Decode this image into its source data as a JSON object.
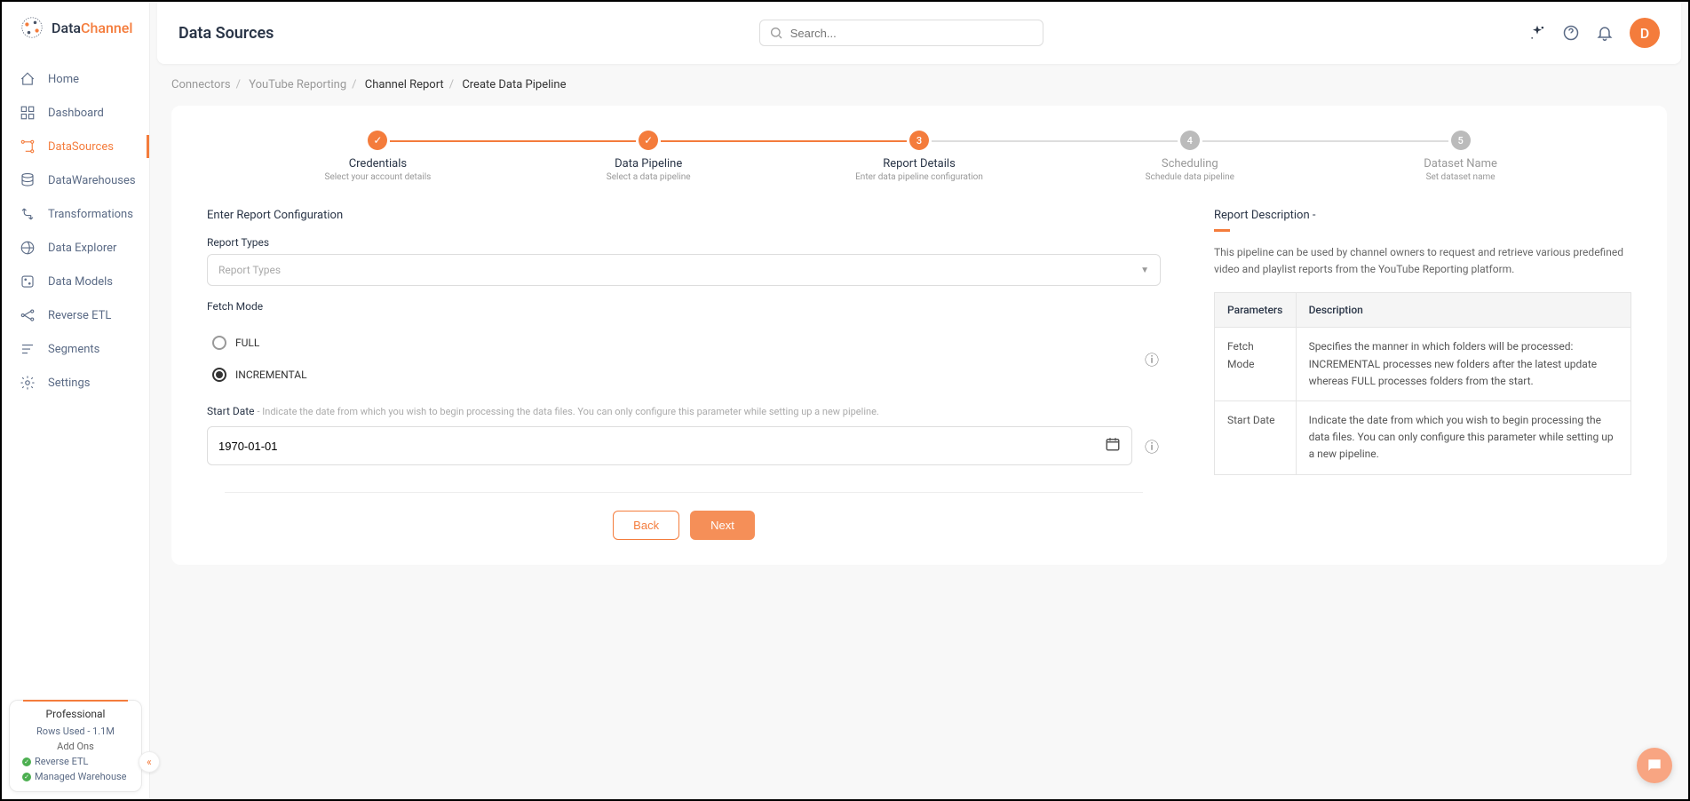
{
  "logo": {
    "brand1": "Data",
    "brand2": "Channel"
  },
  "pageTitle": "Data Sources",
  "search": {
    "placeholder": "Search..."
  },
  "avatar": "D",
  "sidebar": {
    "items": [
      {
        "label": "Home"
      },
      {
        "label": "Dashboard"
      },
      {
        "label": "DataSources"
      },
      {
        "label": "DataWarehouses"
      },
      {
        "label": "Transformations"
      },
      {
        "label": "Data Explorer"
      },
      {
        "label": "Data Models"
      },
      {
        "label": "Reverse ETL"
      },
      {
        "label": "Segments"
      },
      {
        "label": "Settings"
      }
    ]
  },
  "plan": {
    "title": "Professional",
    "rowsUsed": "Rows Used - 1.1M",
    "addonsHeading": "Add Ons",
    "addons": [
      "Reverse ETL",
      "Managed Warehouse"
    ]
  },
  "breadcrumb": {
    "items": [
      "Connectors",
      "YouTube Reporting",
      "Channel Report",
      "Create Data Pipeline"
    ]
  },
  "stepper": [
    {
      "title": "Credentials",
      "subtitle": "Select your account details",
      "state": "done",
      "num": ""
    },
    {
      "title": "Data Pipeline",
      "subtitle": "Select a data pipeline",
      "state": "done",
      "num": ""
    },
    {
      "title": "Report Details",
      "subtitle": "Enter data pipeline configuration",
      "state": "active",
      "num": "3"
    },
    {
      "title": "Scheduling",
      "subtitle": "Schedule data pipeline",
      "state": "pending",
      "num": "4"
    },
    {
      "title": "Dataset Name",
      "subtitle": "Set dataset name",
      "state": "pending",
      "num": "5"
    }
  ],
  "form": {
    "heading": "Enter Report Configuration",
    "reportTypesLabel": "Report Types",
    "reportTypesPlaceholder": "Report Types",
    "fetchModeLabel": "Fetch Mode",
    "fetchModes": {
      "full": "FULL",
      "incremental": "INCREMENTAL"
    },
    "startDateLabel": "Start Date",
    "startDateHelp": "- Indicate the date from which you wish to begin processing the data files. You can only configure this parameter while setting up a new pipeline.",
    "startDateValue": "1970-01-01",
    "backBtn": "Back",
    "nextBtn": "Next"
  },
  "description": {
    "title": "Report Description -",
    "text": "This pipeline can be used by channel owners to request and retrieve various predefined video and playlist reports from the YouTube Reporting platform.",
    "headers": {
      "param": "Parameters",
      "desc": "Description"
    },
    "rows": [
      {
        "param": "Fetch Mode",
        "desc": "Specifies the manner in which folders will be processed: INCREMENTAL processes new folders after the latest update whereas FULL processes folders from the start."
      },
      {
        "param": "Start Date",
        "desc": "Indicate the date from which you wish to begin processing the data files. You can only configure this parameter while setting up a new pipeline."
      }
    ]
  }
}
